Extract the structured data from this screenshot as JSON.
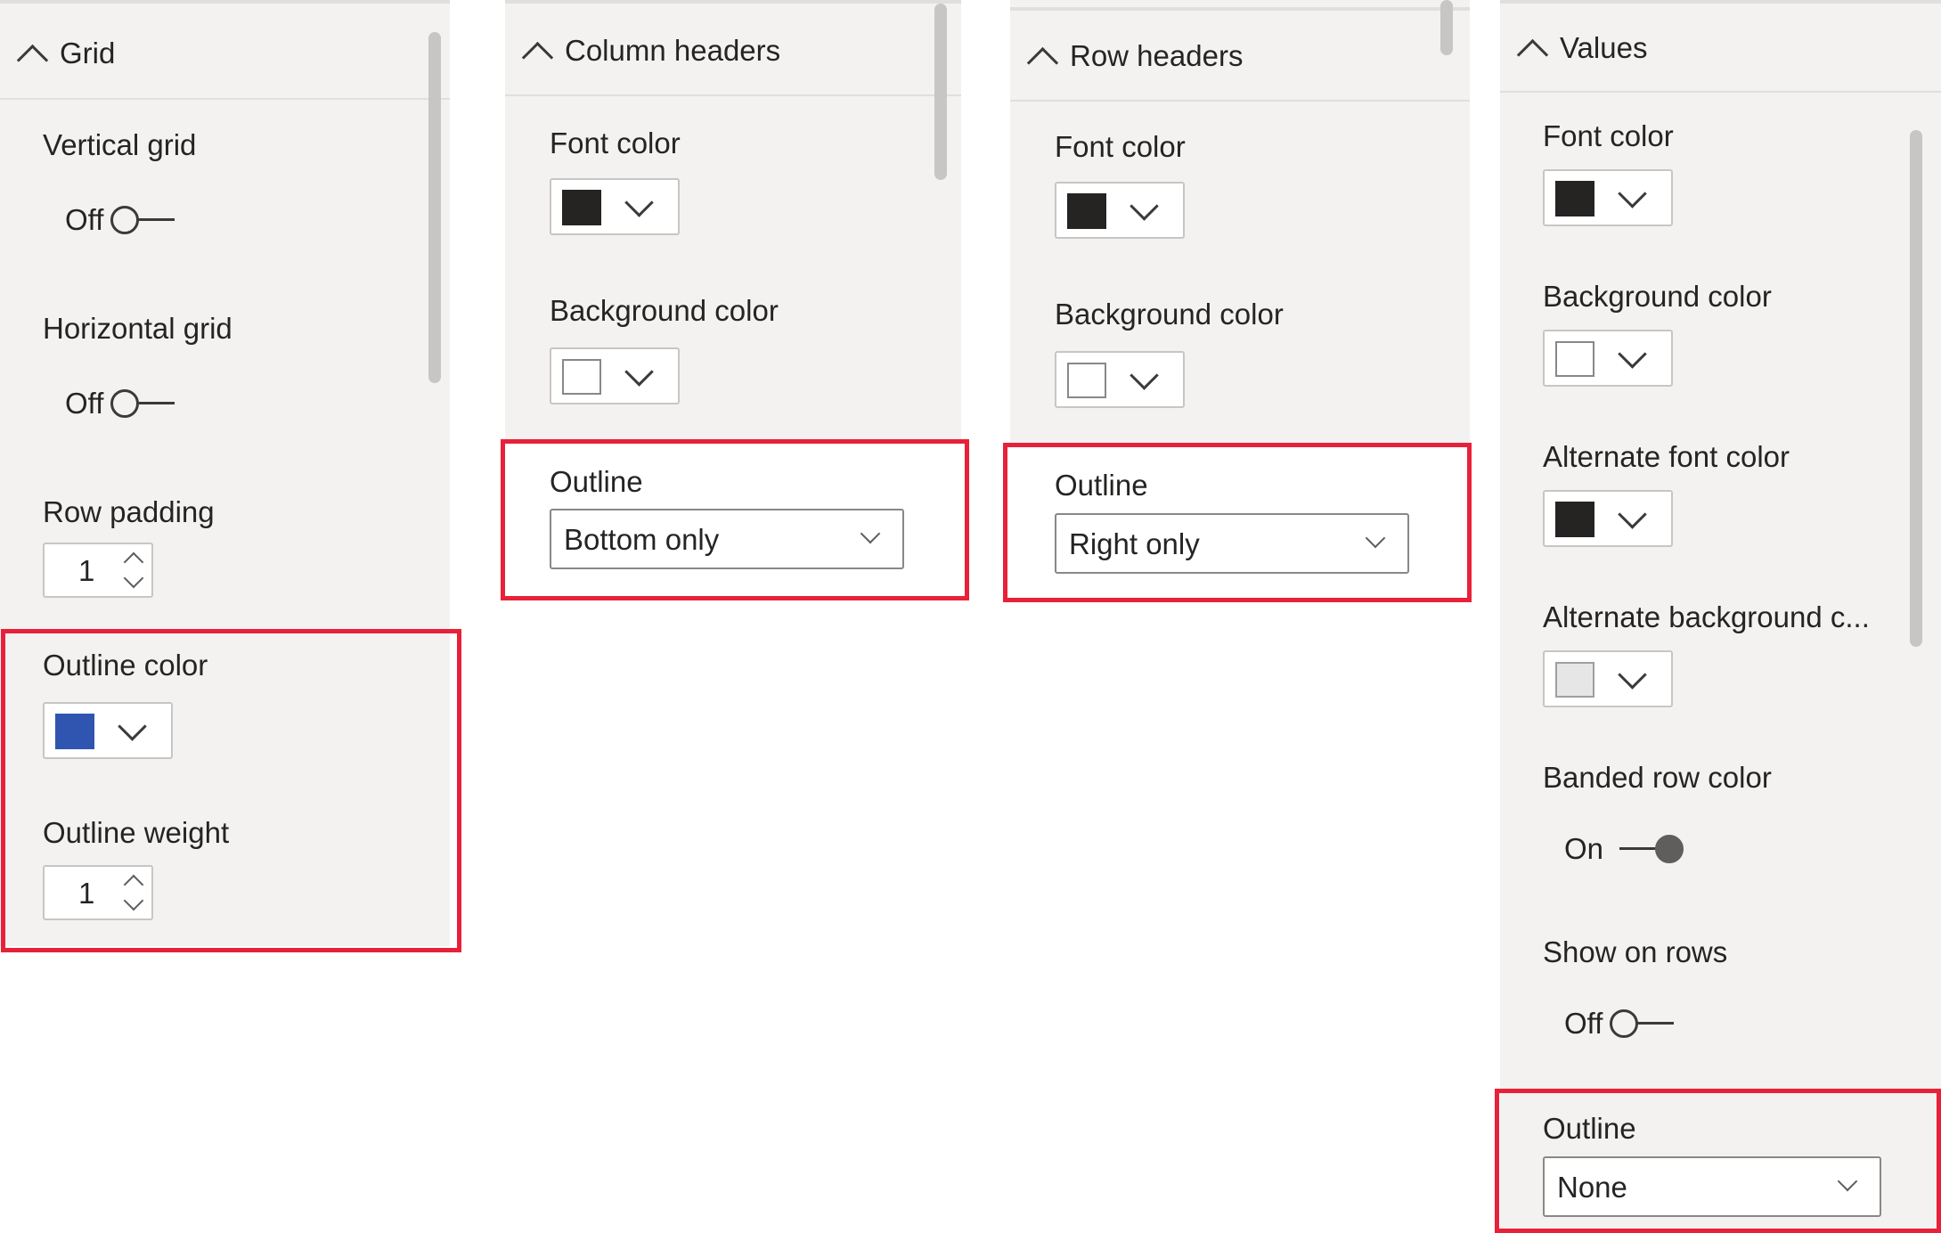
{
  "colors": {
    "panel_bg": "#f3f2f1",
    "highlight": "#e8213a",
    "outline_color": "#2f55b0",
    "black_swatch": "#252423",
    "white_swatch": "#ffffff",
    "alt_bg_swatch": "#e6e6e6"
  },
  "grid": {
    "title": "Grid",
    "vertical_grid": {
      "label": "Vertical grid",
      "state": "Off"
    },
    "horizontal_grid": {
      "label": "Horizontal grid",
      "state": "Off"
    },
    "row_padding": {
      "label": "Row padding",
      "value": "1"
    },
    "outline_color": {
      "label": "Outline color"
    },
    "outline_weight": {
      "label": "Outline weight",
      "value": "1"
    }
  },
  "column_headers": {
    "title": "Column headers",
    "font_color": {
      "label": "Font color"
    },
    "background_color": {
      "label": "Background color"
    },
    "outline": {
      "label": "Outline",
      "value": "Bottom only"
    }
  },
  "row_headers": {
    "title": "Row headers",
    "font_color": {
      "label": "Font color"
    },
    "background_color": {
      "label": "Background color"
    },
    "outline": {
      "label": "Outline",
      "value": "Right only"
    }
  },
  "values": {
    "title": "Values",
    "font_color": {
      "label": "Font color"
    },
    "background_color": {
      "label": "Background color"
    },
    "alt_font_color": {
      "label": "Alternate font color"
    },
    "alt_background_color": {
      "label": "Alternate background c..."
    },
    "banded_row_color": {
      "label": "Banded row color",
      "state": "On"
    },
    "show_on_rows": {
      "label": "Show on rows",
      "state": "Off"
    },
    "outline": {
      "label": "Outline",
      "value": "None"
    }
  }
}
